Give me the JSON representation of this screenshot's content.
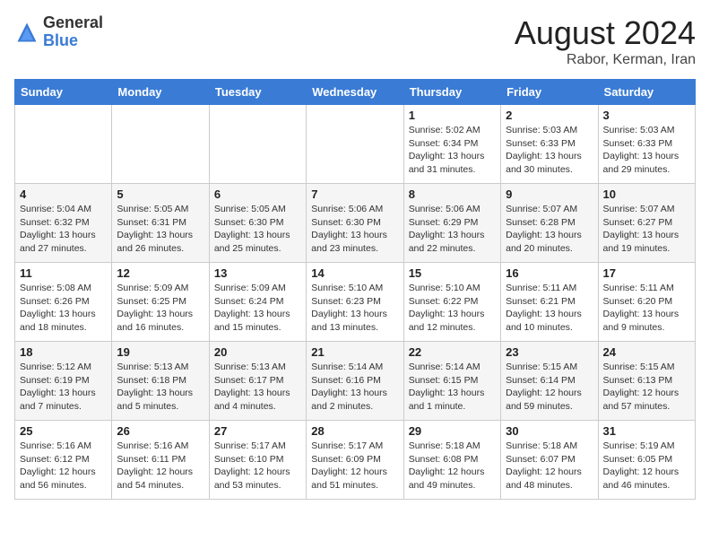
{
  "header": {
    "logo_general": "General",
    "logo_blue": "Blue",
    "month_title": "August 2024",
    "subtitle": "Rabor, Kerman, Iran"
  },
  "days_of_week": [
    "Sunday",
    "Monday",
    "Tuesday",
    "Wednesday",
    "Thursday",
    "Friday",
    "Saturday"
  ],
  "weeks": [
    [
      {
        "day": "",
        "info": ""
      },
      {
        "day": "",
        "info": ""
      },
      {
        "day": "",
        "info": ""
      },
      {
        "day": "",
        "info": ""
      },
      {
        "day": "1",
        "info": "Sunrise: 5:02 AM\nSunset: 6:34 PM\nDaylight: 13 hours and 31 minutes."
      },
      {
        "day": "2",
        "info": "Sunrise: 5:03 AM\nSunset: 6:33 PM\nDaylight: 13 hours and 30 minutes."
      },
      {
        "day": "3",
        "info": "Sunrise: 5:03 AM\nSunset: 6:33 PM\nDaylight: 13 hours and 29 minutes."
      }
    ],
    [
      {
        "day": "4",
        "info": "Sunrise: 5:04 AM\nSunset: 6:32 PM\nDaylight: 13 hours and 27 minutes."
      },
      {
        "day": "5",
        "info": "Sunrise: 5:05 AM\nSunset: 6:31 PM\nDaylight: 13 hours and 26 minutes."
      },
      {
        "day": "6",
        "info": "Sunrise: 5:05 AM\nSunset: 6:30 PM\nDaylight: 13 hours and 25 minutes."
      },
      {
        "day": "7",
        "info": "Sunrise: 5:06 AM\nSunset: 6:30 PM\nDaylight: 13 hours and 23 minutes."
      },
      {
        "day": "8",
        "info": "Sunrise: 5:06 AM\nSunset: 6:29 PM\nDaylight: 13 hours and 22 minutes."
      },
      {
        "day": "9",
        "info": "Sunrise: 5:07 AM\nSunset: 6:28 PM\nDaylight: 13 hours and 20 minutes."
      },
      {
        "day": "10",
        "info": "Sunrise: 5:07 AM\nSunset: 6:27 PM\nDaylight: 13 hours and 19 minutes."
      }
    ],
    [
      {
        "day": "11",
        "info": "Sunrise: 5:08 AM\nSunset: 6:26 PM\nDaylight: 13 hours and 18 minutes."
      },
      {
        "day": "12",
        "info": "Sunrise: 5:09 AM\nSunset: 6:25 PM\nDaylight: 13 hours and 16 minutes."
      },
      {
        "day": "13",
        "info": "Sunrise: 5:09 AM\nSunset: 6:24 PM\nDaylight: 13 hours and 15 minutes."
      },
      {
        "day": "14",
        "info": "Sunrise: 5:10 AM\nSunset: 6:23 PM\nDaylight: 13 hours and 13 minutes."
      },
      {
        "day": "15",
        "info": "Sunrise: 5:10 AM\nSunset: 6:22 PM\nDaylight: 13 hours and 12 minutes."
      },
      {
        "day": "16",
        "info": "Sunrise: 5:11 AM\nSunset: 6:21 PM\nDaylight: 13 hours and 10 minutes."
      },
      {
        "day": "17",
        "info": "Sunrise: 5:11 AM\nSunset: 6:20 PM\nDaylight: 13 hours and 9 minutes."
      }
    ],
    [
      {
        "day": "18",
        "info": "Sunrise: 5:12 AM\nSunset: 6:19 PM\nDaylight: 13 hours and 7 minutes."
      },
      {
        "day": "19",
        "info": "Sunrise: 5:13 AM\nSunset: 6:18 PM\nDaylight: 13 hours and 5 minutes."
      },
      {
        "day": "20",
        "info": "Sunrise: 5:13 AM\nSunset: 6:17 PM\nDaylight: 13 hours and 4 minutes."
      },
      {
        "day": "21",
        "info": "Sunrise: 5:14 AM\nSunset: 6:16 PM\nDaylight: 13 hours and 2 minutes."
      },
      {
        "day": "22",
        "info": "Sunrise: 5:14 AM\nSunset: 6:15 PM\nDaylight: 13 hours and 1 minute."
      },
      {
        "day": "23",
        "info": "Sunrise: 5:15 AM\nSunset: 6:14 PM\nDaylight: 12 hours and 59 minutes."
      },
      {
        "day": "24",
        "info": "Sunrise: 5:15 AM\nSunset: 6:13 PM\nDaylight: 12 hours and 57 minutes."
      }
    ],
    [
      {
        "day": "25",
        "info": "Sunrise: 5:16 AM\nSunset: 6:12 PM\nDaylight: 12 hours and 56 minutes."
      },
      {
        "day": "26",
        "info": "Sunrise: 5:16 AM\nSunset: 6:11 PM\nDaylight: 12 hours and 54 minutes."
      },
      {
        "day": "27",
        "info": "Sunrise: 5:17 AM\nSunset: 6:10 PM\nDaylight: 12 hours and 53 minutes."
      },
      {
        "day": "28",
        "info": "Sunrise: 5:17 AM\nSunset: 6:09 PM\nDaylight: 12 hours and 51 minutes."
      },
      {
        "day": "29",
        "info": "Sunrise: 5:18 AM\nSunset: 6:08 PM\nDaylight: 12 hours and 49 minutes."
      },
      {
        "day": "30",
        "info": "Sunrise: 5:18 AM\nSunset: 6:07 PM\nDaylight: 12 hours and 48 minutes."
      },
      {
        "day": "31",
        "info": "Sunrise: 5:19 AM\nSunset: 6:05 PM\nDaylight: 12 hours and 46 minutes."
      }
    ]
  ]
}
